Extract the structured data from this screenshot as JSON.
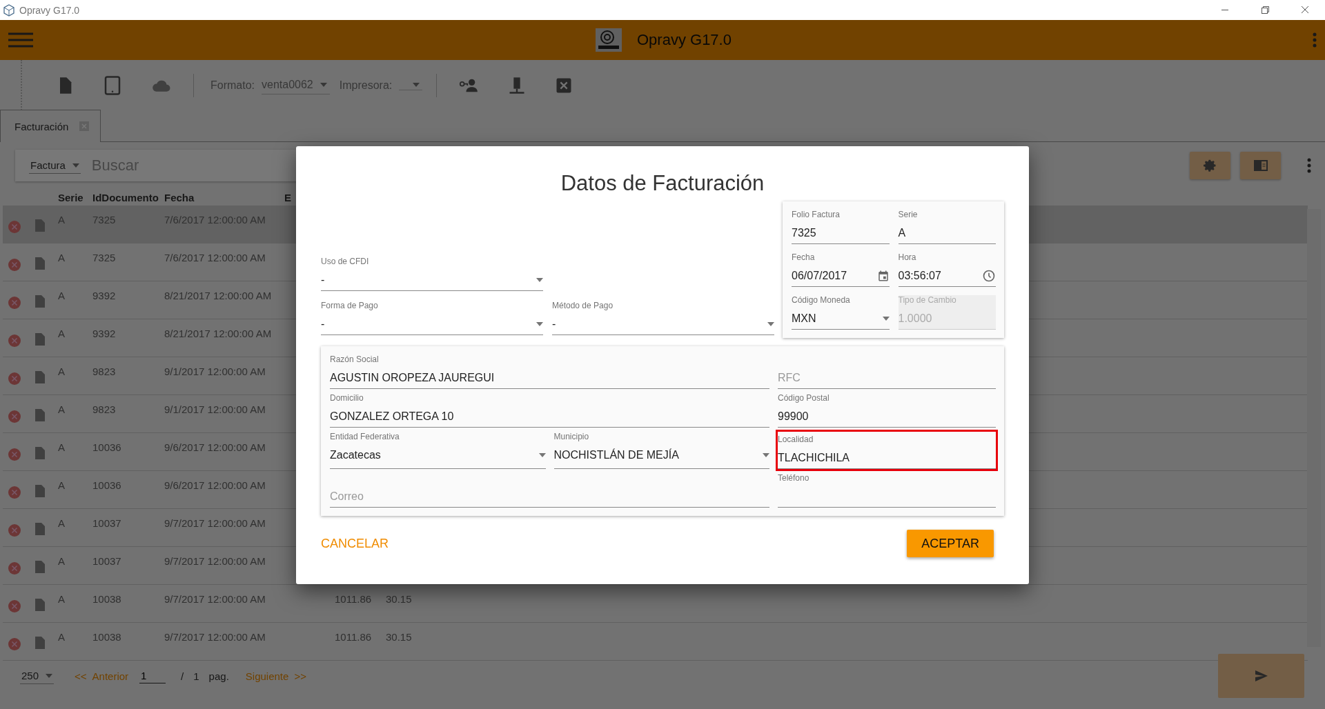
{
  "window": {
    "title": "Opravy G17.0"
  },
  "header": {
    "title": "Opravy G17.0"
  },
  "toolbar": {
    "formato_label": "Formato:",
    "formato_value": "venta0062",
    "impresora_label": "Impresora:"
  },
  "tabs": [
    {
      "label": "Facturación",
      "selected": true
    }
  ],
  "search": {
    "type_value": "Factura",
    "placeholder": "Buscar"
  },
  "table": {
    "columns": [
      "Serie",
      "IdDocumento",
      "Fecha",
      "E"
    ],
    "rows": [
      {
        "selected": true,
        "serie": "A",
        "id": "7325",
        "fecha": "7/6/2017 12:00:00 AM"
      },
      {
        "selected": false,
        "serie": "A",
        "id": "7325",
        "fecha": "7/6/2017 12:00:00 AM"
      },
      {
        "selected": false,
        "serie": "A",
        "id": "9392",
        "fecha": "8/21/2017 12:00:00 AM"
      },
      {
        "selected": false,
        "serie": "A",
        "id": "9392",
        "fecha": "8/21/2017 12:00:00 AM"
      },
      {
        "selected": false,
        "serie": "A",
        "id": "9823",
        "fecha": "9/1/2017 12:00:00 AM"
      },
      {
        "selected": false,
        "serie": "A",
        "id": "9823",
        "fecha": "9/1/2017 12:00:00 AM"
      },
      {
        "selected": false,
        "serie": "A",
        "id": "10036",
        "fecha": "9/6/2017 12:00:00 AM"
      },
      {
        "selected": false,
        "serie": "A",
        "id": "10036",
        "fecha": "9/6/2017 12:00:00 AM"
      },
      {
        "selected": false,
        "serie": "A",
        "id": "10037",
        "fecha": "9/7/2017 12:00:00 AM"
      },
      {
        "selected": false,
        "serie": "A",
        "id": "10037",
        "fecha": "9/7/2017 12:00:00 AM"
      },
      {
        "selected": false,
        "serie": "A",
        "id": "10038",
        "fecha": "9/7/2017 12:00:00 AM",
        "column_5": "1011.86",
        "column_6": "30.15"
      },
      {
        "selected": false,
        "serie": "A",
        "id": "10038",
        "fecha": "9/7/2017 12:00:00 AM",
        "column_5": "1011.86",
        "column_6": "30.15"
      }
    ]
  },
  "pager": {
    "page_size": "250",
    "prev_arrows": "<<",
    "prev": "Anterior",
    "page": "1",
    "slash": "/",
    "total": "1",
    "pag": "pag.",
    "next": "Siguiente",
    "next_arrows": ">>"
  },
  "dialog": {
    "title": "Datos de Facturación",
    "payment_fields": [
      {
        "label": "Uso de CFDI",
        "value": "-",
        "kind": "select"
      },
      {
        "label": "Forma de Pago",
        "value": "-",
        "kind": "select"
      },
      {
        "label": "Método de Pago",
        "value": "-",
        "kind": "select"
      }
    ],
    "invoice_fields": [
      {
        "label": "Folio Factura",
        "value": "7325",
        "kind": "text",
        "disabled": false
      },
      {
        "label": "Serie",
        "value": "A",
        "kind": "text",
        "disabled": false
      },
      {
        "label": "Fecha",
        "value": "06/07/2017",
        "kind": "date",
        "disabled": false
      },
      {
        "label": "Hora",
        "value": "03:56:07",
        "kind": "time",
        "disabled": false
      },
      {
        "label": "Código Moneda",
        "value": "MXN",
        "kind": "select",
        "disabled": false
      },
      {
        "label": "Tipo de Cambio",
        "value": "1.0000",
        "kind": "text",
        "disabled": true
      }
    ],
    "client_fields": [
      {
        "label": "Razón Social",
        "value": "AGUSTIN OROPEZA JAUREGUI",
        "kind": "text",
        "highlighted": false
      },
      {
        "placeholder": "RFC",
        "kind": "text",
        "highlighted": false
      },
      {
        "label": "Domicilio",
        "value": "GONZALEZ ORTEGA 10",
        "kind": "text",
        "highlighted": false
      },
      {
        "label": "Código Postal",
        "value": "99900",
        "kind": "text",
        "highlighted": false
      },
      {
        "label": "Entidad Federativa",
        "value": "Zacatecas",
        "kind": "select",
        "highlighted": false
      },
      {
        "label": "Municipio",
        "value": "NOCHISTLÁN DE MEJÍA",
        "kind": "select",
        "highlighted": false
      },
      {
        "label": "Localidad",
        "value": "TLACHICHILA",
        "kind": "text",
        "highlighted": true
      },
      {
        "placeholder": "Correo",
        "kind": "text",
        "highlighted": false
      },
      {
        "label": "Teléfono",
        "kind": "text",
        "highlighted": false
      }
    ],
    "buttons": [
      {
        "label": "CANCELAR",
        "kind": "flat"
      },
      {
        "label": "ACEPTAR",
        "kind": "raised"
      }
    ]
  }
}
